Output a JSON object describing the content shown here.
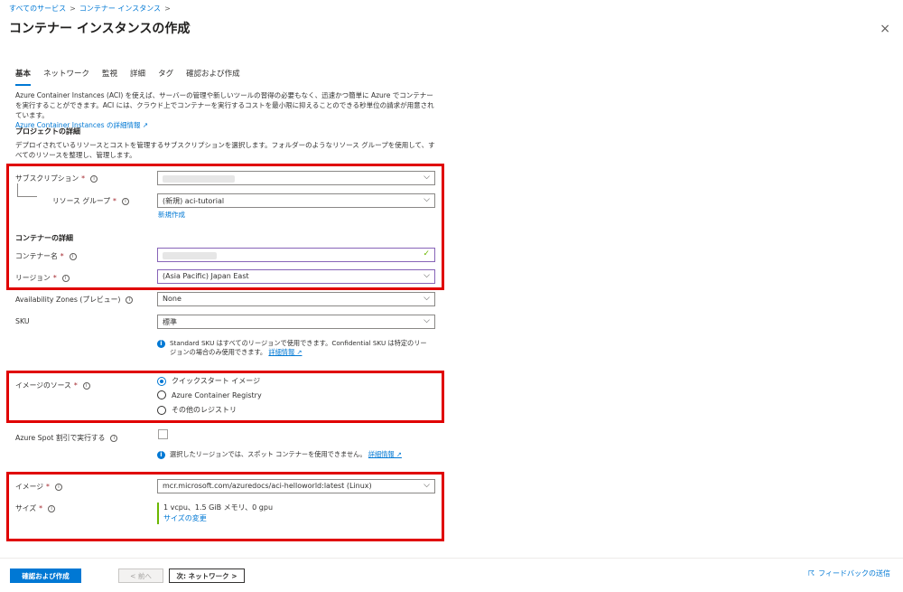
{
  "breadcrumb": {
    "items": [
      "すべてのサービス",
      "コンテナー インスタンス"
    ],
    "sep": ">"
  },
  "header": {
    "title": "コンテナー インスタンスの作成",
    "more": "···",
    "close": "×"
  },
  "tabs": [
    "基本",
    "ネットワーク",
    "監視",
    "詳細",
    "タグ",
    "確認および作成"
  ],
  "intro": {
    "text": "Azure Container Instances (ACI) を使えば、サーバーの管理や新しいツールの習得の必要もなく、迅速かつ簡単に Azure でコンテナーを実行することができます。ACI には、クラウド上でコンテナーを実行するコストを最小限に抑えることのできる秒単位の請求が用意されています。",
    "link": "Azure Container Instances の詳細情報 ↗"
  },
  "project": {
    "heading": "プロジェクトの詳細",
    "description": "デプロイされているリソースとコストを管理するサブスクリプションを選択します。フォルダーのようなリソース グループを使用して、すべてのリソースを整理し、管理します。",
    "subscription_label": "サブスクリプション",
    "resource_group_label": "リソース グループ",
    "resource_group_value": "(新規) aci-tutorial",
    "create_new": "新規作成"
  },
  "container": {
    "heading": "コンテナーの詳細",
    "name_label": "コンテナー名",
    "region_label": "リージョン",
    "region_value": "(Asia Pacific) Japan East",
    "az_label": "Availability Zones (プレビュー)",
    "az_value": "None",
    "sku_label": "SKU",
    "sku_value": "標準",
    "sku_note": "Standard SKU はすべてのリージョンで使用できます。Confidential SKU は特定のリージョンの場合のみ使用できます。",
    "sku_note_link": "詳細情報 ↗"
  },
  "image_source": {
    "label": "イメージのソース",
    "options": [
      "クイックスタート イメージ",
      "Azure Container Registry",
      "その他のレジストリ"
    ],
    "selected": 0
  },
  "spot": {
    "label": "Azure Spot 割引で実行する",
    "note": "選択したリージョンでは、スポット コンテナーを使用できません。",
    "note_link": "詳細情報 ↗"
  },
  "image": {
    "label": "イメージ",
    "value": "mcr.microsoft.com/azuredocs/aci-helloworld:latest (Linux)",
    "size_label": "サイズ",
    "size_value": "1 vcpu、1.5 GiB メモリ、0 gpu",
    "size_link": "サイズの変更"
  },
  "footer": {
    "review_create": "確認および作成",
    "prev": "< 前へ",
    "next": "次: ネットワーク >",
    "feedback": "フィードバックの送信"
  },
  "colors": {
    "accent": "#0078d4",
    "highlight": "#e00000",
    "required": "#a4262c"
  }
}
